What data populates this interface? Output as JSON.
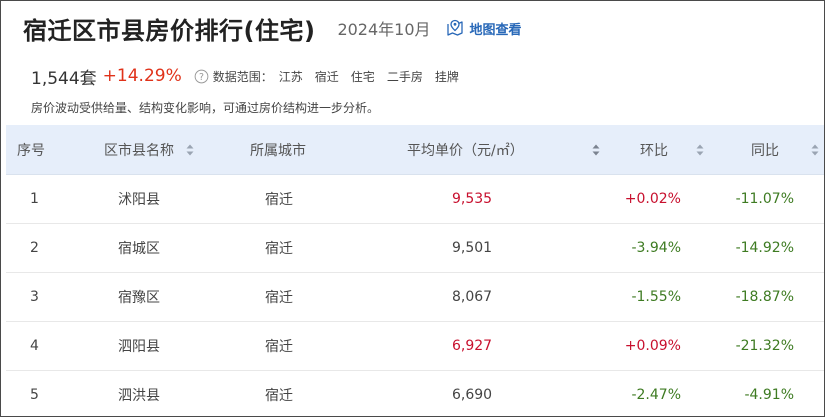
{
  "header": {
    "title": "宿迁区市县房价排行(住宅)",
    "period": "2024年10月",
    "map_link": "地图查看",
    "map_icon": "map-pin-icon"
  },
  "stats": {
    "count": "1,544套",
    "change": "+14.29%",
    "scope_label": "数据范围：",
    "scope_tags": [
      "江苏",
      "宿迁",
      "住宅",
      "二手房",
      "挂牌"
    ],
    "note": "房价波动受供给量、结构变化影响，可通过房价结构进一步分析。"
  },
  "table": {
    "columns": [
      "序号",
      "区市县名称",
      "所属城市",
      "平均单价（元/㎡）",
      "环比",
      "同比"
    ],
    "rows": [
      {
        "rank": "1",
        "name": "沭阳县",
        "city": "宿迁",
        "price": "9,535",
        "mom": "+0.02%",
        "yoy": "-11.07%"
      },
      {
        "rank": "2",
        "name": "宿城区",
        "city": "宿迁",
        "price": "9,501",
        "mom": "-3.94%",
        "yoy": "-14.92%"
      },
      {
        "rank": "3",
        "name": "宿豫区",
        "city": "宿迁",
        "price": "8,067",
        "mom": "-1.55%",
        "yoy": "-18.87%"
      },
      {
        "rank": "4",
        "name": "泗阳县",
        "city": "宿迁",
        "price": "6,927",
        "mom": "+0.09%",
        "yoy": "-21.32%"
      },
      {
        "rank": "5",
        "name": "泗洪县",
        "city": "宿迁",
        "price": "6,690",
        "mom": "-2.47%",
        "yoy": "-4.91%"
      }
    ]
  },
  "colors": {
    "up": "#c8102e",
    "down": "#3e7b22",
    "header_bg": "#e6eefa",
    "link": "#2868b8"
  }
}
